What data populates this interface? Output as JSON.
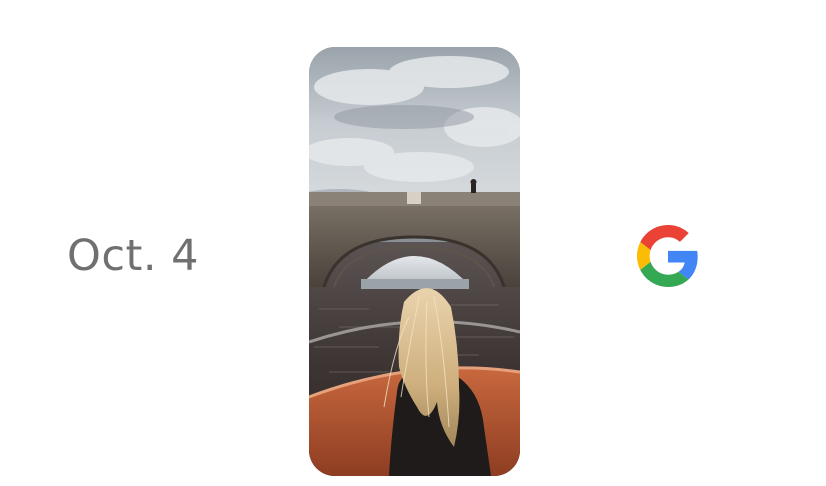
{
  "event": {
    "date_text": "Oct. 4"
  },
  "phone": {
    "icon": "phone-photo",
    "scene": "girl-on-boat-under-bridge"
  },
  "logo": {
    "icon": "google-g-logo",
    "colors": {
      "blue": "#4285F4",
      "red": "#EA4335",
      "yellow": "#FBBC05",
      "green": "#34A853"
    }
  }
}
